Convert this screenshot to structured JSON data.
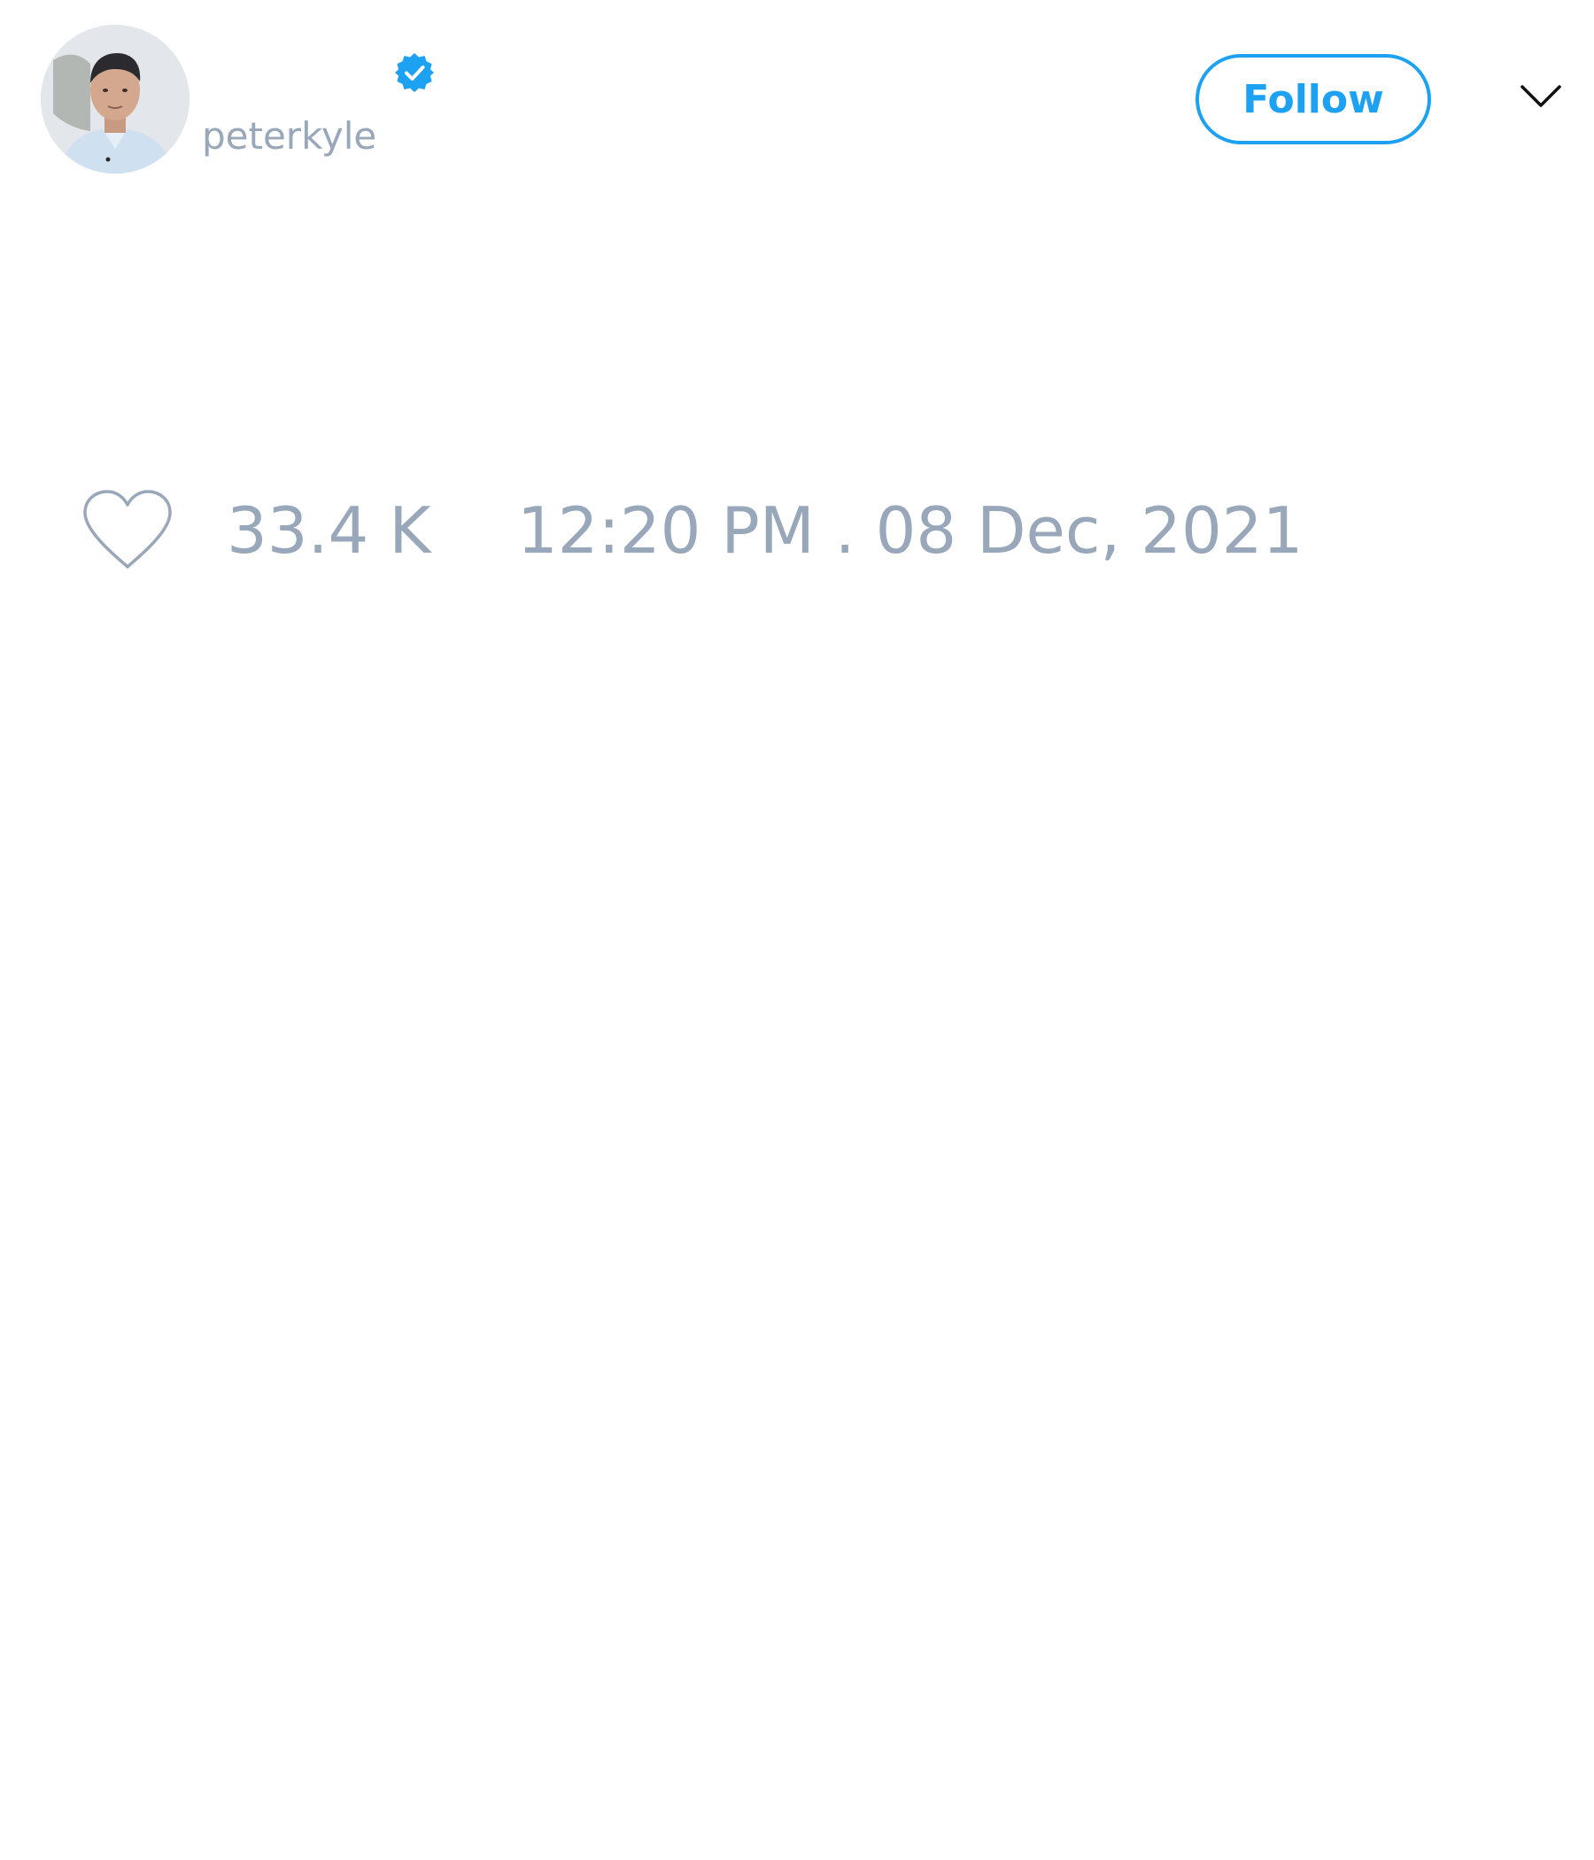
{
  "colors": {
    "accent": "#1da1f2",
    "muted_text": "#98a7b9",
    "chevron": "#111111",
    "heart_outline": "#98a7b9"
  },
  "author": {
    "display_name": "",
    "handle": "peterkyle",
    "verified": true,
    "avatar_icon": "profile-photo"
  },
  "header": {
    "follow_label": "Follow",
    "menu_icon": "chevron-down-icon"
  },
  "stats": {
    "like_icon": "heart-outline-icon",
    "likes": "33.4 K",
    "timestamp": "12:20 PM . 08 Dec, 2021"
  }
}
